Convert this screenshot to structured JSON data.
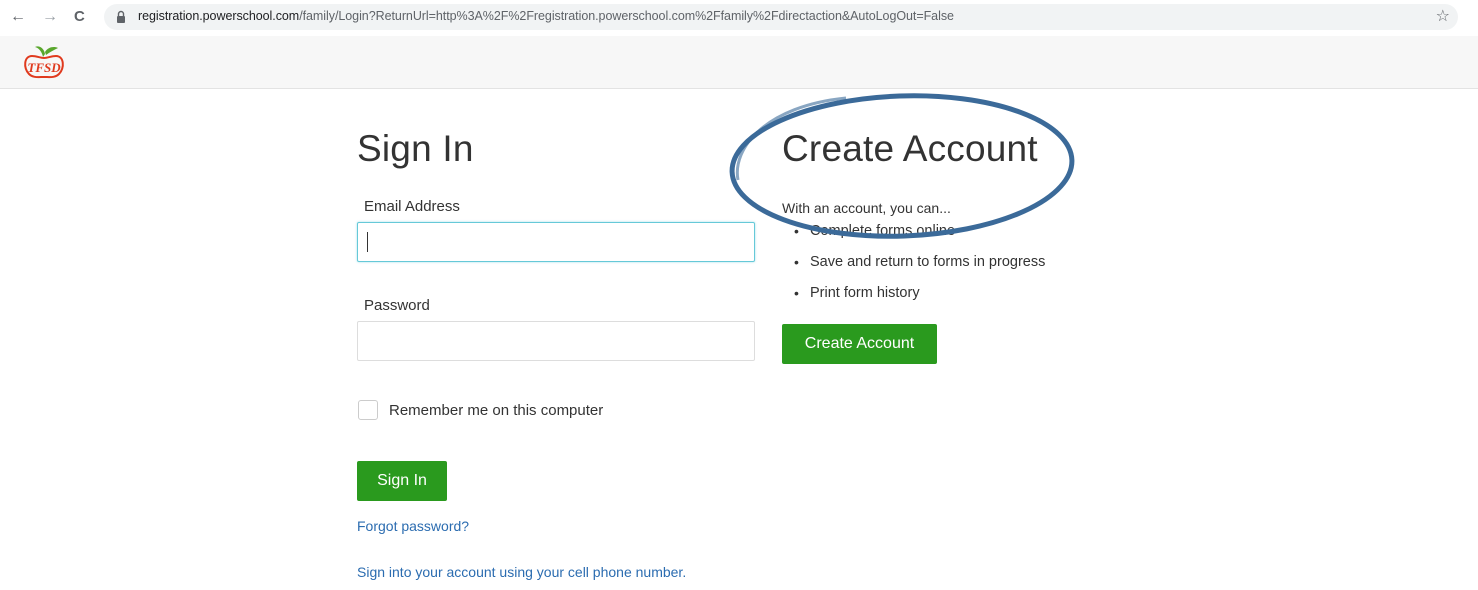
{
  "browser": {
    "url_host": "registration.powerschool.com",
    "url_path": "/family/Login?ReturnUrl=http%3A%2F%2Fregistration.powerschool.com%2Ffamily%2Fdirectaction&AutoLogOut=False",
    "back_icon": "←",
    "forward_icon": "→",
    "reload_icon": "C",
    "star_icon": "☆"
  },
  "header": {
    "logo_text": "TFSD"
  },
  "signin": {
    "title": "Sign In",
    "email_label": "Email Address",
    "email_value": "",
    "password_label": "Password",
    "password_value": "",
    "remember_label": "Remember me on this computer",
    "remember_checked": false,
    "signin_button": "Sign In",
    "forgot_link": "Forgot password?",
    "phone_link": "Sign into your account using your cell phone number."
  },
  "create": {
    "title": "Create Account",
    "intro": "With an account, you can...",
    "benefits": [
      "Complete forms online",
      "Save and return to forms in progress",
      "Print form history"
    ],
    "button": "Create Account"
  },
  "colors": {
    "button_green": "#2a9a1e",
    "link_blue": "#2b6cb0",
    "annotation_ring": "#3b6a99",
    "focus_border": "#66c9d8"
  }
}
